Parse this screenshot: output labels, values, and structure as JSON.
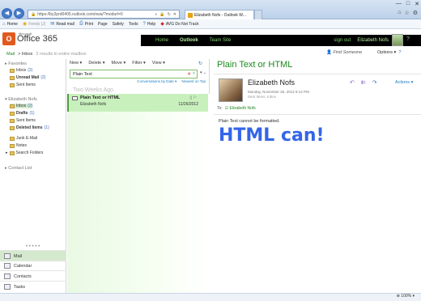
{
  "browser": {
    "url": "https://by2prd0405.outlook.com/owa/?modurl=0",
    "tab_title": "Elizabeth Nofs - Outlook W...",
    "cmd": [
      "Home",
      "Feeds (J)",
      "Read mail",
      "Print",
      "Page",
      "Safety",
      "Tools",
      "Help",
      "AVG Do Not Track"
    ]
  },
  "header": {
    "brand_small": "Microsoft",
    "brand": "Office 365",
    "nav": [
      "Home",
      "Outlook",
      "Team Site"
    ],
    "sign_out": "sign out",
    "user": "Elizabeth Nofs"
  },
  "subhead": {
    "mail": "Mail",
    "crumb": "Inbox",
    "count": "2 results in entire mailbox",
    "find": "Find Someone",
    "options": "Options"
  },
  "leftnav": {
    "favorites": "Favorites",
    "fav_items": [
      {
        "label": "Inbox",
        "count": "(2)"
      },
      {
        "label": "Unread Mail",
        "count": "(2)"
      },
      {
        "label": "Sent Items",
        "count": ""
      }
    ],
    "account": "Elizabeth Nofs",
    "acct_items": [
      {
        "label": "Inbox",
        "count": "(2)"
      },
      {
        "label": "Drafts",
        "count": "(1)"
      },
      {
        "label": "Sent Items",
        "count": ""
      },
      {
        "label": "Deleted Items",
        "count": "(1)"
      },
      {
        "label": "Junk E-Mail",
        "count": ""
      },
      {
        "label": "Notes",
        "count": ""
      },
      {
        "label": "Search Folders",
        "count": ""
      }
    ],
    "contact_list": "Contact List",
    "bottom": [
      "Mail",
      "Calendar",
      "Contacts",
      "Tasks"
    ]
  },
  "list": {
    "tools": [
      "New",
      "Delete",
      "Move",
      "Filter",
      "View"
    ],
    "search_value": "Plain Text",
    "conv_by": "Conversations by Date",
    "newest": "Newest on Top",
    "group": "Two Weeks Ago",
    "message": {
      "subject": "Plain Text or HTML",
      "from": "Elizabeth Nofs",
      "date": "11/26/2012"
    }
  },
  "reading": {
    "subject": "Plain Text or HTML",
    "sender": "Elizabeth Nofs",
    "sent": "Monday, November 26, 2012 8:14 PM",
    "folder": "Sent Items, Inbox",
    "actions": "Actions",
    "to_label": "To:",
    "to_name": "Elizabeth Nofs",
    "body_line": "Plain Text cannot be formatted.",
    "big": "HTML can!"
  },
  "status": {
    "zoom": "100%"
  }
}
